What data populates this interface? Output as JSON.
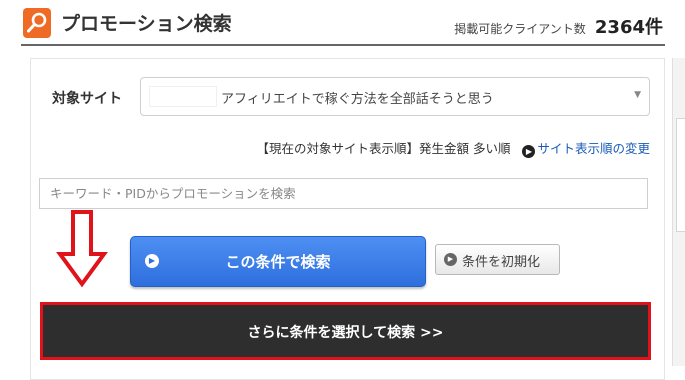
{
  "header": {
    "logo_icon": "search-magnifier-icon",
    "title": "プロモーション検索",
    "client_count_label": "掲載可能クライアント数",
    "client_count_value": "2364件"
  },
  "site_selector": {
    "label": "対象サイト",
    "selected_site": "アフィリエイトで稼ぐ方法を全部話そうと思う",
    "caret_icon": "▼"
  },
  "sort_order": {
    "text": "【現在の対象サイト表示順】発生金額 多い順",
    "link_icon": "circle-arrow-icon",
    "link_label": "サイト表示順の変更"
  },
  "keyword_search": {
    "placeholder": "キーワード・PIDからプロモーションを検索",
    "value": ""
  },
  "buttons": {
    "search_label": "この条件で検索",
    "reset_label": "条件を初期化",
    "more_conditions_label": "さらに条件を選択して検索 >>"
  },
  "annotation": {
    "arrow_icon": "red-down-arrow-icon",
    "highlight_color": "#e0131b"
  },
  "colors": {
    "accent_orange": "#ef6a25",
    "primary_blue": "#2e6fde",
    "dark_button": "#2e2e2e"
  }
}
